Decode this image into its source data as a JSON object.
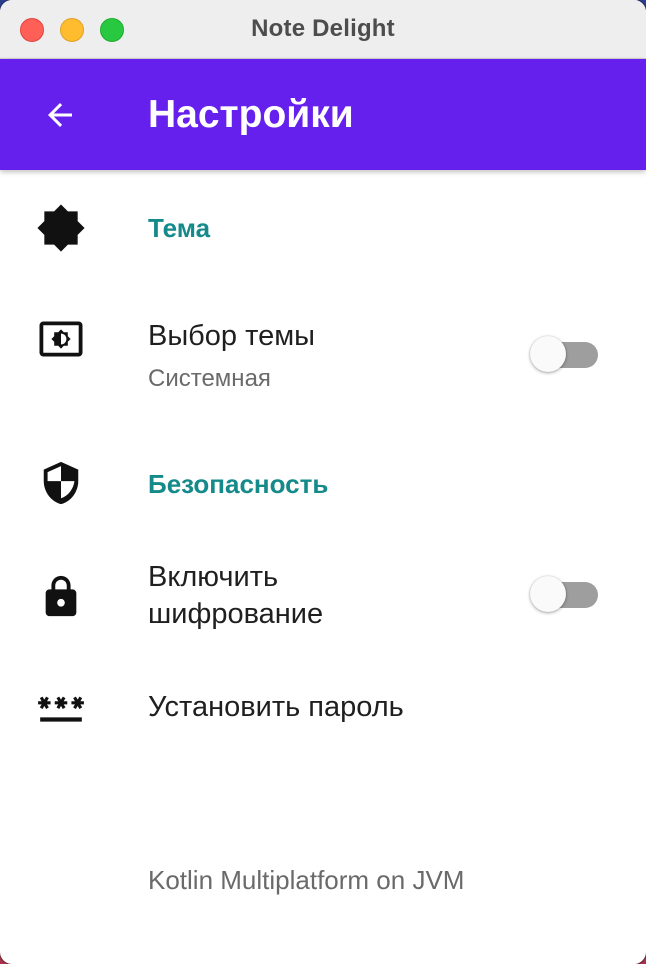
{
  "window": {
    "title": "Note Delight"
  },
  "appbar": {
    "title": "Настройки",
    "back_icon": "arrow-back-icon",
    "color": "#6620ee"
  },
  "sections": {
    "theme": {
      "icon": "brightness-icon",
      "title": "Тема",
      "prefs": {
        "theme_select": {
          "icon": "theme-toggle-icon",
          "title": "Выбор темы",
          "summary": "Системная",
          "switch_on": false
        }
      }
    },
    "security": {
      "icon": "security-shield-icon",
      "title": "Безопасность",
      "prefs": {
        "encryption": {
          "icon": "lock-icon",
          "title_line1": "Включить",
          "title_line2": "шифрование",
          "switch_on": false
        },
        "password": {
          "icon": "password-icon",
          "title": "Установить пароль"
        }
      }
    }
  },
  "footer": {
    "text": "Kotlin Multiplatform on JVM"
  },
  "colors": {
    "accent": "#158a8a",
    "appbar": "#6620ee",
    "switch_track_off": "#9e9e9e"
  }
}
